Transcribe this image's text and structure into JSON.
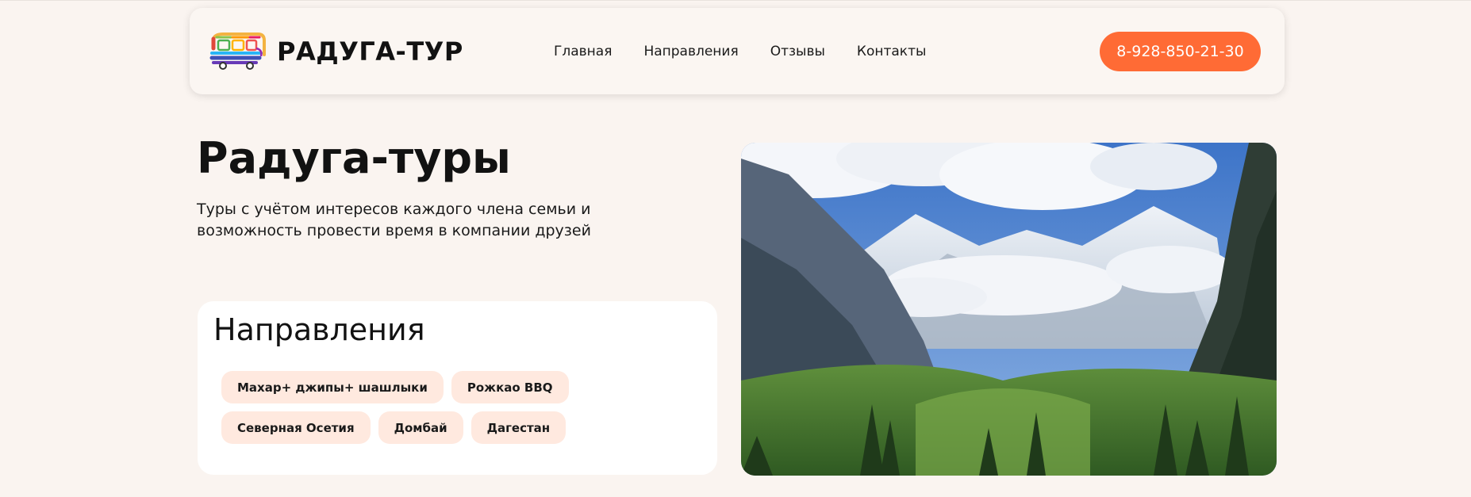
{
  "brand": {
    "name": "РАДУГА-ТУР",
    "logo_icon": "rainbow-bus-icon"
  },
  "nav": {
    "items": [
      {
        "label": "Главная"
      },
      {
        "label": "Направления"
      },
      {
        "label": "Отзывы"
      },
      {
        "label": "Контакты"
      }
    ]
  },
  "header": {
    "phone": "8-928-850-21-30"
  },
  "hero": {
    "title": "Радуга-туры",
    "subtitle": "Туры с учётом интересов каждого члена семьи и возможность провести время в компании друзей",
    "image_icon": "mountain-landscape-photo"
  },
  "directions": {
    "title": "Направления",
    "items": [
      {
        "label": "Махар+ джипы+ шашлыки"
      },
      {
        "label": "Рожкао BBQ"
      },
      {
        "label": "Северная Осетия"
      },
      {
        "label": "Домбай"
      },
      {
        "label": "Дагестан"
      }
    ]
  },
  "colors": {
    "accent": "#ff6b35",
    "page_background": "#faf4f0",
    "chip_background": "#ffe9df",
    "card_background": "#ffffff"
  }
}
